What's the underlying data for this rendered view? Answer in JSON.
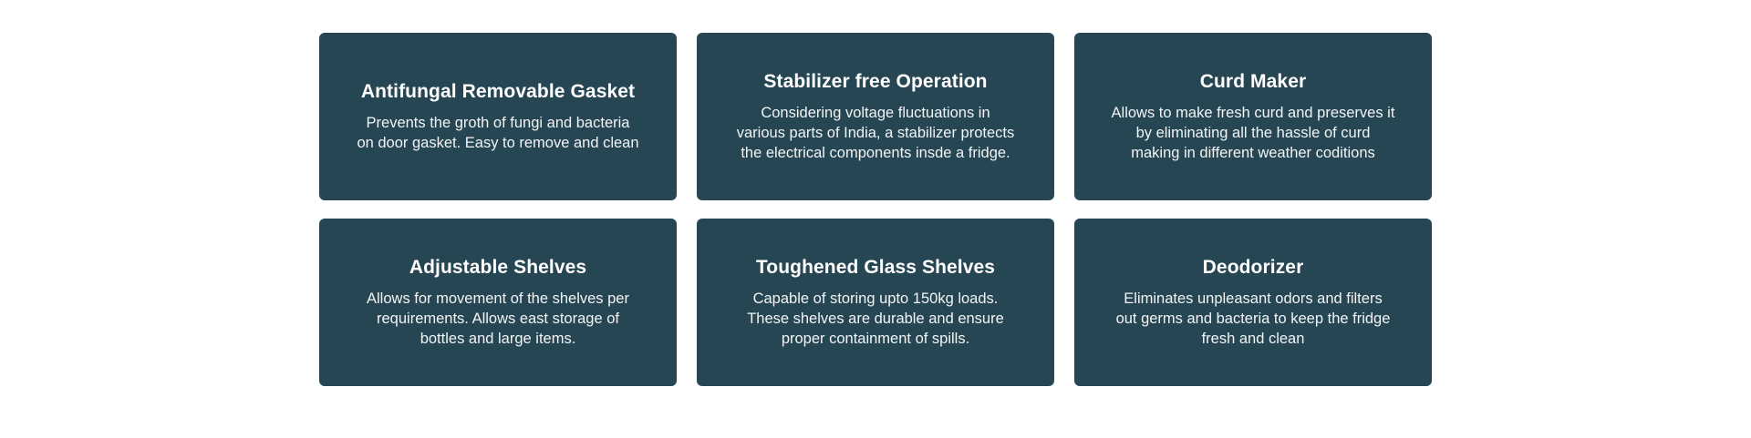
{
  "colors": {
    "card_background": "#264653",
    "card_text": "#ffffff",
    "page_background": "#ffffff"
  },
  "features": [
    {
      "title": "Antifungal Removable Gasket",
      "description": "Prevents the groth of fungi and bacteria\non door gasket. Easy to remove and clean"
    },
    {
      "title": "Stabilizer free Operation",
      "description": "Considering voltage fluctuations in\nvarious parts of India,  a stabilizer protects\nthe electrical components insde a fridge."
    },
    {
      "title": "Curd Maker",
      "description": "Allows to make fresh curd and preserves it\nby eliminating all the hassle of curd\nmaking in different weather coditions"
    },
    {
      "title": "Adjustable Shelves",
      "description": "Allows for movement of the shelves  per\nrequirements. Allows east storage of\nbottles and large items."
    },
    {
      "title": "Toughened Glass Shelves",
      "description": "Capable of storing upto 150kg loads.\nThese shelves are durable and ensure\nproper containment of spills."
    },
    {
      "title": "Deodorizer",
      "description": "Eliminates unpleasant odors and filters\nout germs and bacteria to keep the fridge\nfresh and clean"
    }
  ]
}
